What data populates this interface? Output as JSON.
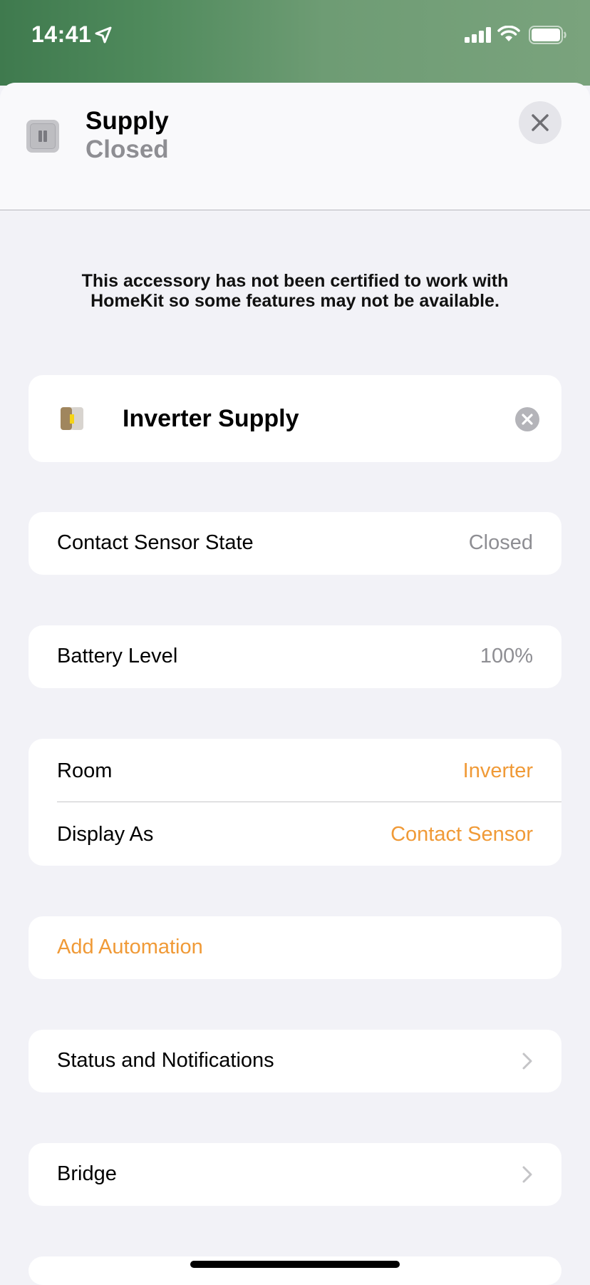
{
  "status_bar": {
    "time": "14:41"
  },
  "header": {
    "title": "Supply",
    "subtitle": "Closed",
    "close_icon": "close-icon"
  },
  "notice": "This accessory has not been certified to work with HomeKit so some features may not be available.",
  "accessory": {
    "name": "Inverter Supply",
    "icon": "contact-sensor-icon"
  },
  "contact_sensor": {
    "label": "Contact Sensor State",
    "value": "Closed"
  },
  "battery": {
    "label": "Battery Level",
    "value": "100%"
  },
  "room": {
    "label": "Room",
    "value": "Inverter"
  },
  "display_as": {
    "label": "Display As",
    "value": "Contact Sensor"
  },
  "automation": {
    "label": "Add Automation"
  },
  "status_notifications": {
    "label": "Status and Notifications"
  },
  "bridge": {
    "label": "Bridge"
  },
  "colors": {
    "accent": "#f09a37",
    "status_bar_green": "#4f8a5c",
    "background": "#f2f2f7"
  }
}
